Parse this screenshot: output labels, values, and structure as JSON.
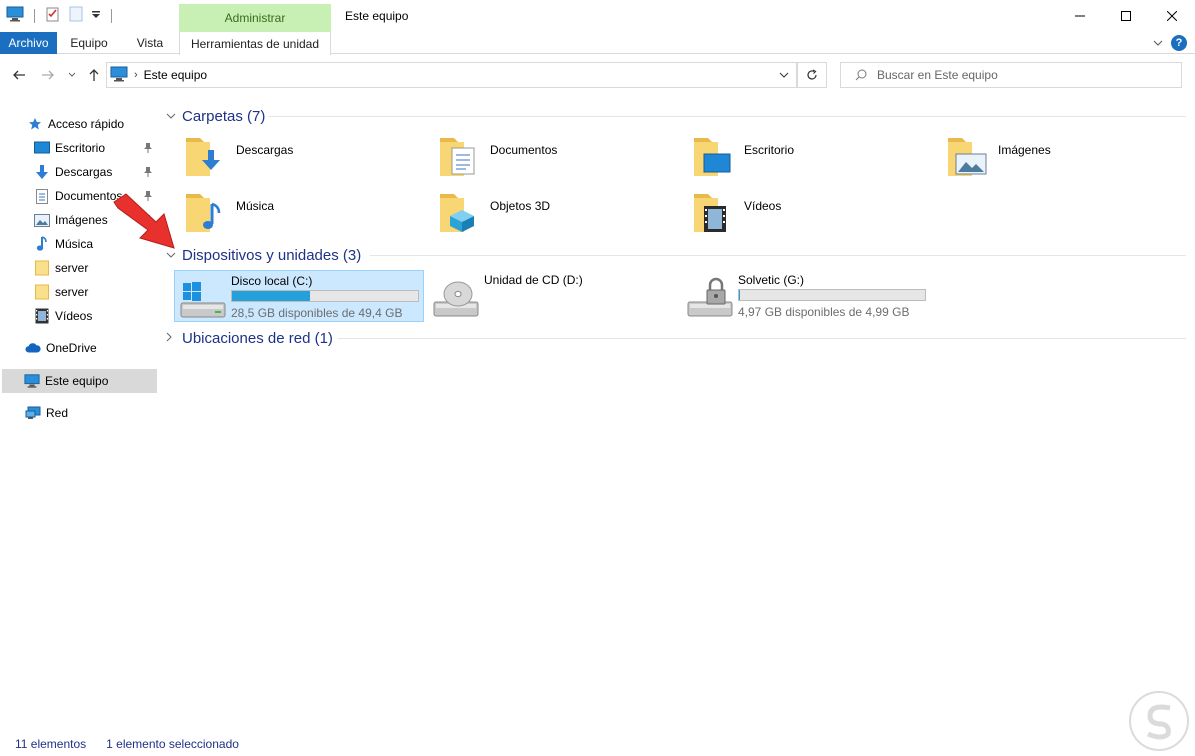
{
  "window": {
    "title": "Este equipo",
    "contextual_tab": "Administrar"
  },
  "ribbon": {
    "tabs": [
      "Archivo",
      "Equipo",
      "Vista",
      "Herramientas de unidad"
    ]
  },
  "address": {
    "path": "Este equipo",
    "search_placeholder": "Buscar en Este equipo"
  },
  "sidebar": {
    "items": [
      {
        "label": "Acceso rápido",
        "icon": "star-icon"
      },
      {
        "label": "Escritorio",
        "icon": "desktop-icon",
        "pinned": true
      },
      {
        "label": "Descargas",
        "icon": "download-icon",
        "pinned": true
      },
      {
        "label": "Documentos",
        "icon": "document-icon",
        "pinned": true
      },
      {
        "label": "Imágenes",
        "icon": "image-icon",
        "pinned": true
      },
      {
        "label": "Música",
        "icon": "music-icon"
      },
      {
        "label": "server",
        "icon": "folder-icon"
      },
      {
        "label": "server",
        "icon": "folder-icon"
      },
      {
        "label": "Vídeos",
        "icon": "video-icon"
      },
      {
        "label": "OneDrive",
        "icon": "cloud-icon"
      },
      {
        "label": "Este equipo",
        "icon": "computer-icon",
        "selected": true
      },
      {
        "label": "Red",
        "icon": "network-icon"
      }
    ]
  },
  "groups": {
    "folders": {
      "title": "Carpetas (7)",
      "items": [
        "Descargas",
        "Documentos",
        "Escritorio",
        "Imágenes",
        "Música",
        "Objetos 3D",
        "Vídeos"
      ]
    },
    "devices": {
      "title": "Dispositivos y unidades (3)",
      "items": [
        {
          "name": "Disco local (C:)",
          "free": "28,5 GB disponibles de 49,4 GB",
          "used_fraction": 0.42,
          "selected": true
        },
        {
          "name": "Unidad de CD (D:)",
          "free": "",
          "used_fraction": null
        },
        {
          "name": "Solvetic (G:)",
          "free": "4,97 GB disponibles de 4,99 GB",
          "used_fraction": 0.004
        }
      ]
    },
    "network": {
      "title": "Ubicaciones de red (1)"
    }
  },
  "status": {
    "count": "11 elementos",
    "selection": "1 elemento seleccionado"
  },
  "colors": {
    "accent": "#1a6fc1",
    "manage_tab": "#c9f0b4",
    "selection": "#cce8ff",
    "bar_fill": "#26a0da",
    "arrow": "#e8312c"
  }
}
